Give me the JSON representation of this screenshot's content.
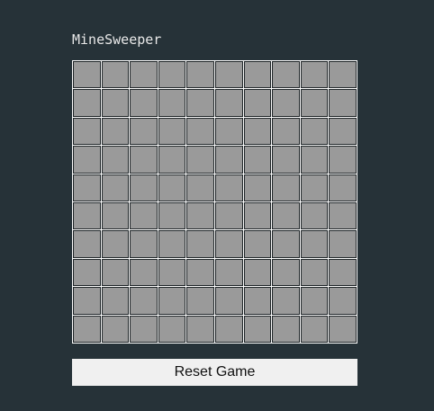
{
  "game": {
    "title": "MineSweeper",
    "rows": 10,
    "cols": 10,
    "cell_state": "covered"
  },
  "controls": {
    "reset_label": "Reset Game"
  },
  "colors": {
    "background": "#263238",
    "cell_covered": "#9a9a9a",
    "grid_line": "#ffffff",
    "button_bg": "#f0f0f0"
  }
}
